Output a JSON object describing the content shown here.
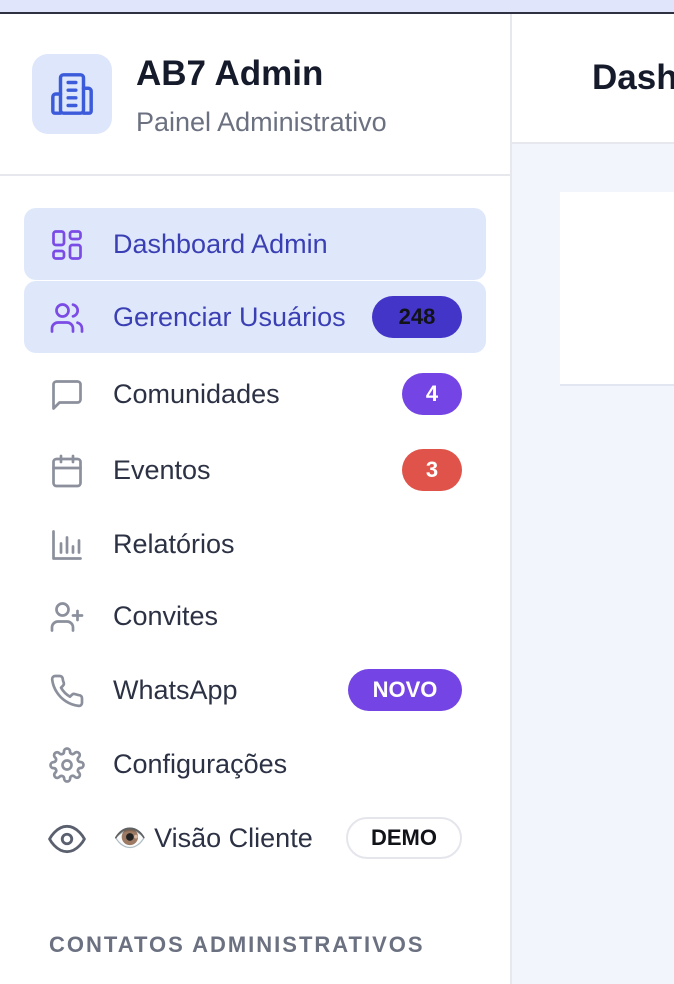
{
  "brand": {
    "title": "AB7 Admin",
    "subtitle": "Painel Administrativo",
    "logo_icon": "building-icon"
  },
  "nav": [
    {
      "label": "Dashboard Admin",
      "icon": "grid-icon",
      "active": true
    },
    {
      "label": "Gerenciar Usuários",
      "icon": "users-icon",
      "active": true,
      "badge": "248"
    },
    {
      "label": "Comunidades",
      "icon": "message-square-icon",
      "badge": "4"
    },
    {
      "label": "Eventos",
      "icon": "calendar-icon",
      "badge": "3"
    },
    {
      "label": "Relatórios",
      "icon": "bar-chart-icon"
    },
    {
      "label": "Convites",
      "icon": "user-plus-icon"
    },
    {
      "label": "WhatsApp",
      "icon": "phone-icon",
      "badge": "NOVO"
    },
    {
      "label": "Configurações",
      "icon": "gear-icon"
    },
    {
      "label": "👁️ Visão Cliente",
      "icon": "eye-icon",
      "badge": "DEMO"
    }
  ],
  "section": {
    "title": "CONTATOS ADMINISTRATIVOS"
  },
  "main": {
    "title": "Dashboard"
  },
  "colors": {
    "accent": "#3b3fb4",
    "active_bg": "#dfe8fb",
    "badge_count": "#4335c8",
    "badge_purple": "#7444e4",
    "badge_red": "#e0534a"
  }
}
